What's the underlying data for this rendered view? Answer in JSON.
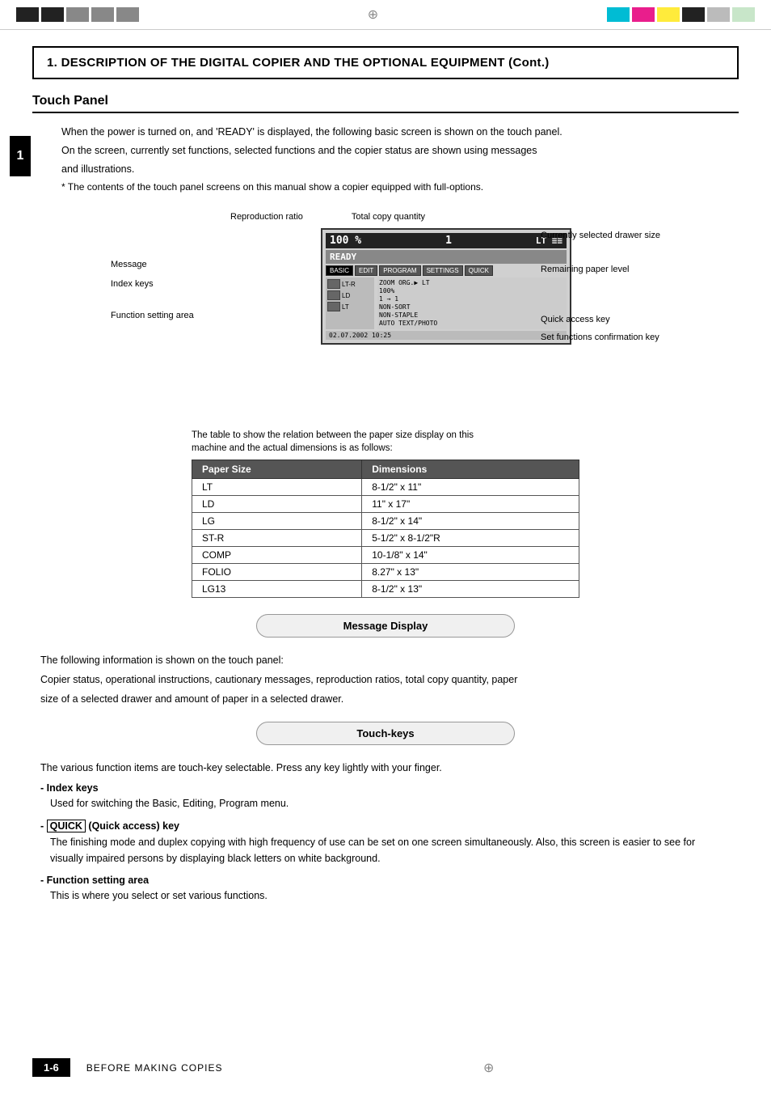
{
  "topBar": {
    "leftBlocks": [
      "dark",
      "dark",
      "dark",
      "dark",
      "dark"
    ],
    "centerSymbol": "⊕",
    "rightBlocks": [
      "cyan",
      "magenta",
      "yellow",
      "black",
      "lgray",
      "lgreen"
    ]
  },
  "header": {
    "chapterTitle": "1. DESCRIPTION OF THE DIGITAL COPIER AND THE OPTIONAL EQUIPMENT (Cont.)"
  },
  "section": {
    "title": "Touch Panel"
  },
  "introText": {
    "line1": "When the power is turned on, and 'READY' is displayed, the following basic screen is shown on the touch panel.",
    "line2": "On the screen, currently set functions, selected functions and the copier status are shown using messages",
    "line3": "and illustrations.",
    "note": "* The contents of the touch panel screens on this manual show a copier equipped with full-options."
  },
  "diagram": {
    "annotations": {
      "reproductionRatio": "Reproduction ratio",
      "totalCopyQuantity": "Total copy quantity",
      "currentlySelectedDrawerSize": "Currently selected drawer size",
      "remainingPaperLevel": "Remaining paper level",
      "message": "Message",
      "indexKeys": "Index keys",
      "quickAccessKey": "Quick access key",
      "setFunctionsConfirmationKey": "Set functions confirmation key",
      "functionSettingArea": "Function setting area"
    },
    "screen": {
      "topRow": "100 %   1   LT ≡≡≡",
      "readyText": "READY",
      "keys": [
        "BASIC",
        "EDIT",
        "PROGRAM",
        "SETTINGS",
        "QUICK"
      ],
      "activeKey": "BASIC",
      "functionArea": {
        "leftItems": [
          "LT-R",
          "LD",
          "LT"
        ],
        "rightLines": [
          "ZOOM  ORG.▶ LT",
          "100%",
          "1 → 1",
          "NON-SORT",
          "NON-STAPLE",
          "AUTO",
          "TEXT/PHOTO"
        ]
      },
      "bottomRow": "02.07.2002 10:25"
    }
  },
  "tableDesc": {
    "line1": "The table to show the relation between the paper size display on this",
    "line2": "machine  and  the  actual  dimensions  is  as  follows:"
  },
  "paperTable": {
    "headers": [
      "Paper Size",
      "Dimensions"
    ],
    "rows": [
      [
        "LT",
        "8-1/2\"  x  11\""
      ],
      [
        "LD",
        "11\"       x  17\""
      ],
      [
        "LG",
        "8-1/2\"  x  14\""
      ],
      [
        "ST-R",
        "5-1/2\"  x  8-1/2\"R"
      ],
      [
        "COMP",
        "10-1/8\"  x  14\""
      ],
      [
        "FOLIO",
        "8.27\"   x  13\""
      ],
      [
        "LG13",
        "8-1/2\"  x  13\""
      ]
    ]
  },
  "messageDisplayBox": {
    "label": "Message Display"
  },
  "messageDisplayText": {
    "line1": "The following information is shown on the touch panel:",
    "line2": "Copier status, operational instructions, cautionary messages, reproduction ratios, total copy quantity, paper",
    "line3": "size of a selected drawer and amount of paper in a selected drawer."
  },
  "touchKeysBox": {
    "label": "Touch-keys"
  },
  "touchKeysIntro": "The various function items are touch-key selectable. Press any key lightly with your finger.",
  "touchKeyItems": [
    {
      "label": "Index keys",
      "desc": "Used for switching the Basic, Editing, Program menu."
    },
    {
      "label": "QUICK (Quick access) key",
      "desc": "The finishing mode and duplex copying with high frequency of use can be set on one screen simultaneously.  Also, this screen is easier to see for visually impaired persons by displaying black letters on white background.",
      "hasQuickBox": true
    },
    {
      "label": "Function setting area",
      "desc": "This is where you select or set various functions."
    }
  ],
  "footer": {
    "pageNum": "1-6",
    "text": "BEFORE MAKING COPIES",
    "centerSymbol": "⊕"
  },
  "tabNumber": "1"
}
